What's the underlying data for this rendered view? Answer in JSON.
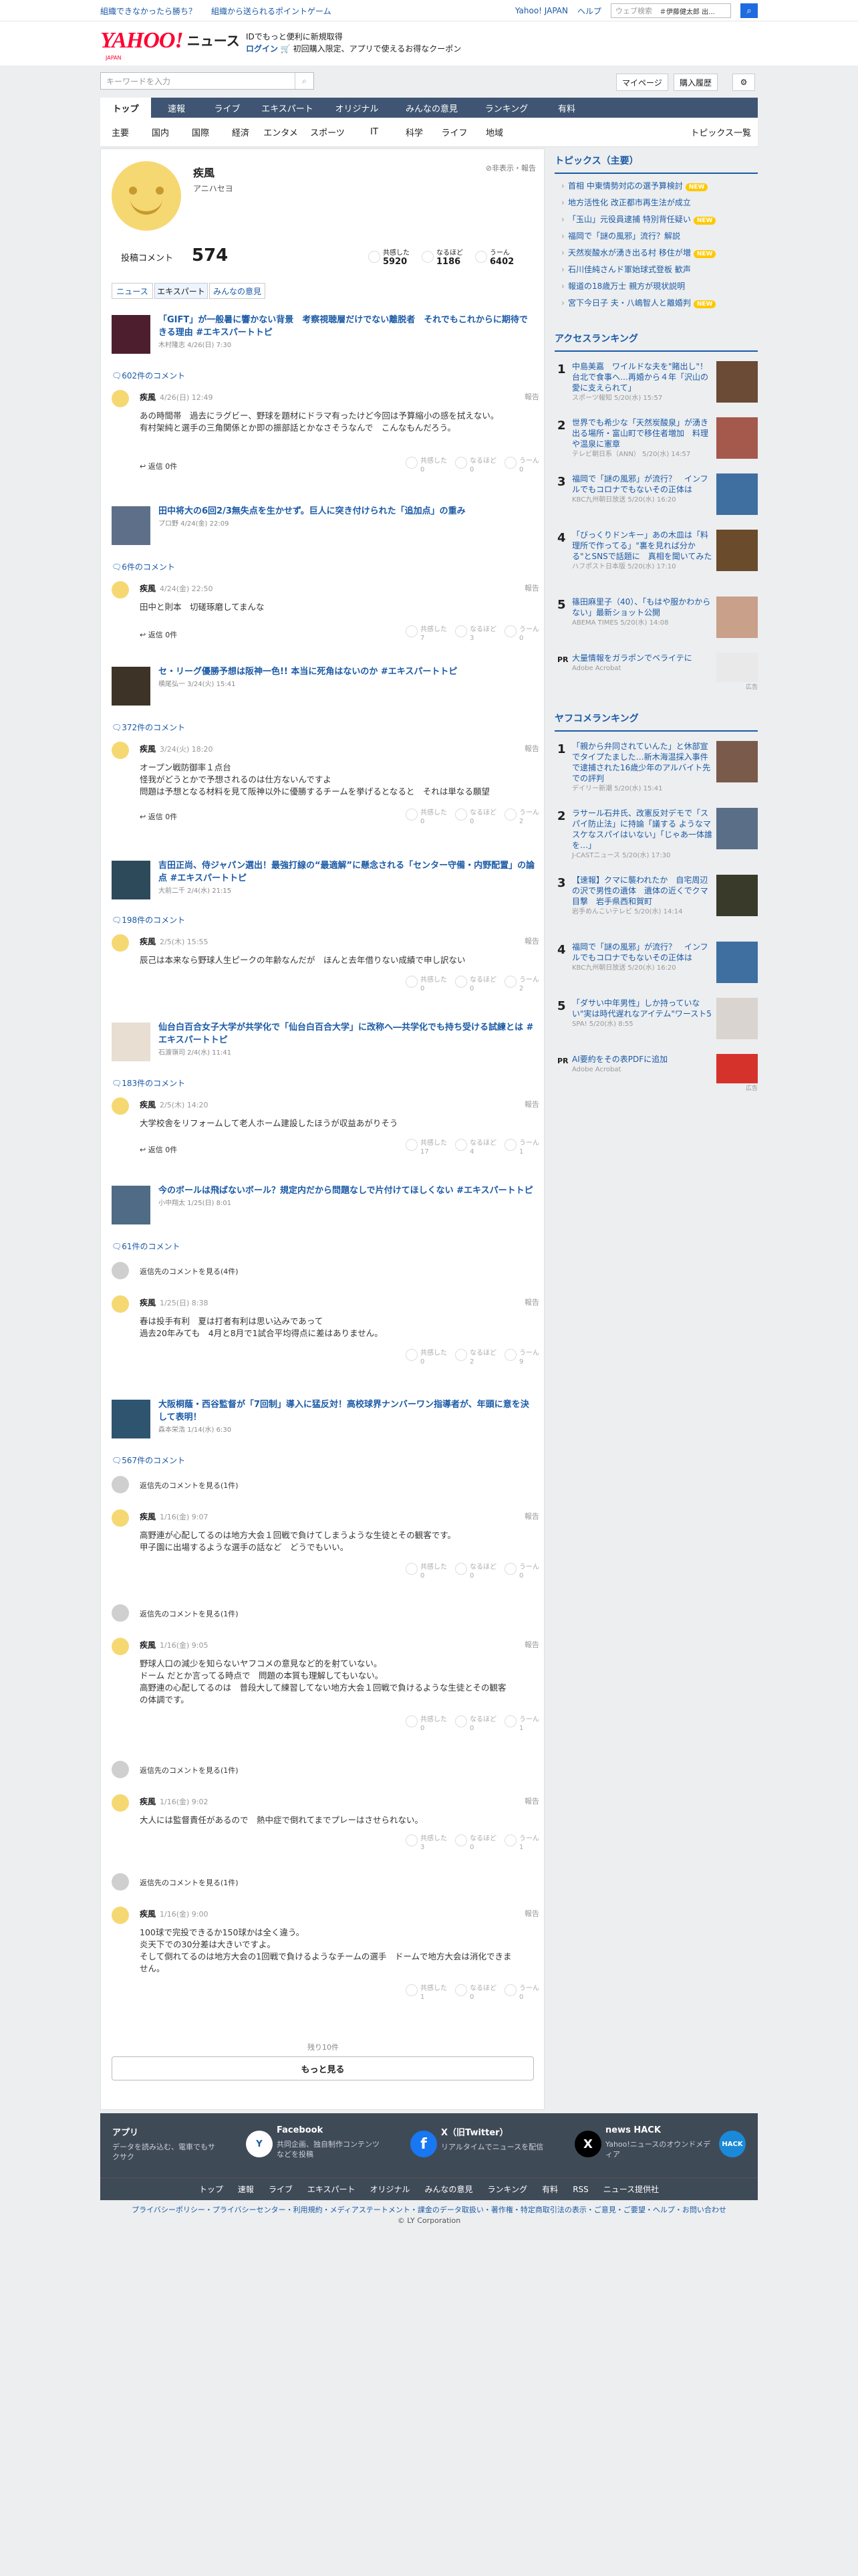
{
  "topbar": {
    "left_links": [
      "組織できなかったら勝ち？",
      "組織から送られるポイントゲーム"
    ],
    "right_links": [
      "Yahoo! JAPAN",
      "ヘルプ"
    ],
    "search_placeholder": "ウェブ検索",
    "search_value": "＃伊藤健太郎 出..."
  },
  "header": {
    "logo_text": "YAHOO!",
    "logo_sub": "JAPAN",
    "section": "ニュース",
    "promo_line1": "IDでもっと便利に新規取得",
    "promo_line2_prefix": "ログイン",
    "promo_line2": "初回購入限定、アプリで使えるお得なクーポン"
  },
  "subheader": {
    "keyword_placeholder": "キーワードを入力",
    "mypage": "マイページ",
    "purchase_history": "購入履歴"
  },
  "gnav": [
    "トップ",
    "速報",
    "ライブ",
    "エキスパート",
    "オリジナル",
    "みんなの意見",
    "ランキング",
    "有料"
  ],
  "snav": {
    "items": [
      "主要",
      "国内",
      "国際",
      "経済",
      "エンタメ",
      "スポーツ",
      "IT",
      "科学",
      "ライフ",
      "地域"
    ],
    "topics_list": "トピックス一覧"
  },
  "profile": {
    "name": "疾風",
    "reading": "アニハセヨ",
    "hide_report": "非表示・報告",
    "comments_label": "投稿コメント",
    "comments_count": "574",
    "stats": [
      {
        "label": "共感した",
        "value": "5920"
      },
      {
        "label": "なるほど",
        "value": "1186"
      },
      {
        "label": "うーん",
        "value": "6402"
      }
    ],
    "tabs": [
      "ニュース",
      "エキスパート",
      "みんなの意見"
    ]
  },
  "articles": [
    {
      "title": "「GIFT」が一般暑に響かない背景　考察視聴層だけでない離脱者　それでもこれからに期待できる理由 #エキスパートトピ",
      "meta": "木村隆志 4/26(日) 7:30",
      "comments": "602件のコメント"
    },
    {
      "title": "田中将大の6回2/3無失点を生かせず。巨人に突き付けられた「追加点」の重み",
      "meta": "プロ野 4/24(金) 22:09",
      "comments": "6件のコメント"
    },
    {
      "title": "セ・リーグ優勝予想は阪神一色!! 本当に死角はないのか #エキスパートトピ",
      "meta": "横尾弘一 3/24(火) 15:41",
      "comments": "372件のコメント"
    },
    {
      "title": "吉田正尚、侍ジャパン選出！最強打線の“最適解”に懸念される「センター守備・内野配置」の論点 #エキスパートトピ",
      "meta": "大前二千 2/4(水) 21:15",
      "comments": "198件のコメント"
    },
    {
      "title": "仙台白百合女子大学が共学化で「仙台白百合大学」に改称へ―共学化でも持ち受ける試練とは #エキスパートトピ",
      "meta": "石渡嶺司 2/4(水) 11:41",
      "comments": "183件のコメント"
    },
    {
      "title": "今のボールは飛ばないボール？規定内だから問題なしで片付けてほしくない #エキスパートトピ",
      "meta": "小中翔太 1/25(日) 8:01",
      "comments": "61件のコメント"
    },
    {
      "title": "大阪桐蔭・西谷監督が「7回制」導入に猛反対！高校球界ナンバーワン指導者が、年頭に意を決して表明！",
      "meta": "森本栄浩 1/14(水) 6:30",
      "comments": "567件のコメント"
    }
  ],
  "comments": [
    {
      "name": "疾風",
      "date": "4/26(日) 12:49",
      "report": "報告",
      "body": "あの時間帯　過去にラグビー、野球を題材にドラマ有ったけど今回は予算縮小の感を拭えない。\n有村架純と選手の三角関係とか即の振部話とかなさそうなんで　こんなもんだろう。",
      "reply": "返信 0件",
      "reacts": [
        "0",
        "0",
        "0"
      ]
    },
    {
      "name": "疾風",
      "date": "4/24(金) 22:50",
      "report": "報告",
      "body": "田中と則本　切磋琢磨してまんな",
      "reply": "返信 0件",
      "reacts": [
        "7",
        "3",
        "0"
      ]
    },
    {
      "name": "疾風",
      "date": "3/24(火) 18:20",
      "report": "報告",
      "body": "オープン戦防御率１点台\n怪我がどうとかで予想されるのは仕方ないんですよ\n問題は予想となる材料を見て阪神以外に優勝するチームを挙げるとなると　それは単なる願望",
      "reply": "返信 0件",
      "reacts": [
        "0",
        "0",
        "2"
      ]
    },
    {
      "name": "疾風",
      "date": "2/5(木) 15:55",
      "report": "報告",
      "body": "辰己は本来なら野球人生ピークの年齢なんだが　ほんと去年借りない成績で申し訳ない",
      "reply": "",
      "reacts": [
        "0",
        "0",
        "2"
      ]
    },
    {
      "name": "疾風",
      "date": "2/5(木) 14:20",
      "report": "報告",
      "body": "大学校舎をリフォームして老人ホーム建設したほうが収益あがりそう",
      "reply": "返信 0件",
      "reacts": [
        "17",
        "4",
        "1"
      ]
    },
    {
      "name": "疾風",
      "date": "1/25(日) 8:38",
      "report": "報告",
      "body": "春は投手有利　夏は打者有利は思い込みであって\n過去20年みても　4月と8月で1試合平均得点に差はありません。",
      "reply": "",
      "reacts": [
        "0",
        "2",
        "9"
      ]
    },
    {
      "name": "疾風",
      "date": "1/16(金) 9:07",
      "report": "報告",
      "body": "高野連が心配してるのは地方大会１回戦で負けてしまうような生徒とその観客です。\n甲子園に出場するような選手の話など　どうでもいい。",
      "reply": "",
      "reacts": [
        "0",
        "0",
        "0"
      ]
    },
    {
      "name": "疾風",
      "date": "1/16(金) 9:05",
      "report": "報告",
      "body": "野球人口の減少を知らないヤフコメの意見など的を射ていない。\nドーム だとか言ってる時点で　問題の本質も理解してもいない。\n高野連の心配してるのは　普段大して練習してない地方大会１回戦で負けるような生徒とその観客の体調です。",
      "reply": "",
      "reacts": [
        "0",
        "0",
        "1"
      ]
    },
    {
      "name": "疾風",
      "date": "1/16(金) 9:02",
      "report": "報告",
      "body": "大人には監督責任があるので　熱中症で倒れてまでプレーはさせられない。",
      "reply": "",
      "reacts": [
        "3",
        "0",
        "1"
      ]
    },
    {
      "name": "疾風",
      "date": "1/16(金) 9:00",
      "report": "報告",
      "body": "100球で完投できるか150球かは全く違う。\n炎天下での30分差は大きいですよ。\nそして倒れてるのは地方大会の1回戦で負けるようなチームの選手　ドームで地方大会は消化できません。",
      "reply": "",
      "reacts": [
        "1",
        "0",
        "0"
      ]
    }
  ],
  "react_labels": [
    "共感した",
    "なるほど",
    "うーん"
  ],
  "more_replies": "返信先のコメントを見る(1件)",
  "more_replies_4": "返信先のコメントを見る(4件)",
  "remaining": "残り10件",
  "load_more": "もっと見る",
  "sidebar": {
    "topics_title": "トピックス（主要）",
    "topics": [
      {
        "text": "首相 中東情勢対応の選予算検討",
        "new": true
      },
      {
        "text": "地方活性化 改正都市再生法が成立",
        "new": false
      },
      {
        "text": "「玉山」元役員逮捕 特別背任疑い",
        "new": true
      },
      {
        "text": "福岡で「謎の風邪」流行？解説",
        "new": false
      },
      {
        "text": "天然炭酸水が湧き出る村 移住が増",
        "new": true
      },
      {
        "text": "石川佳純さんド軍始球式登板 歓声",
        "new": false
      },
      {
        "text": "報道の18歳万士 親方が現状説明",
        "new": false
      },
      {
        "text": "宮下今日子 夫・八嶋智人と離婚判",
        "new": true
      }
    ],
    "new_label": "NEW",
    "access_title": "アクセスランキング",
    "access": [
      {
        "title": "中島美嘉　ワイルドな夫を\"賭出し\"！台北で食事へ…再婚から４年「沢山の愛に支えられて」",
        "meta": "スポーツ報知 5/20(水) 15:57"
      },
      {
        "title": "世界でも希少な「天然炭酸泉」が湧き出る場所・富山町で移住者増加　料理や温泉に憲章",
        "meta": "テレビ朝日系（ANN） 5/20(水) 14:57"
      },
      {
        "title": "福岡で「謎の風邪」が流行？　インフルでもコロナでもないその正体は",
        "meta": "KBC九州朝日放送 5/20(水) 16:20"
      },
      {
        "title": "「びっくりドンキー」あの木皿は「料理所で作ってる」\"裏を見れば分かる\"とSNSで話題に　真相を聞いてみた",
        "meta": "ハフポスト日本版 5/20(水) 17:10"
      },
      {
        "title": "篠田麻里子（40）、「もはや服かわからない」最新ショット公開",
        "meta": "ABEMA TIMES 5/20(水) 14:08"
      }
    ],
    "pr1_title": "大量情報をガラポンでベライテに",
    "pr1_sponsor": "Adobe Acrobat",
    "ad_label": "広告",
    "yafu_title": "ヤフコメランキング",
    "yafu": [
      {
        "title": "「親から弁同されていんた」と休部宣でタイプたました…新木海温採入事件で逮捕された16歳少年のアルバイト先での評判",
        "meta": "デイリー新潮 5/20(水) 15:41"
      },
      {
        "title": "ラサール石井氏、改憲反対デモで「スパイ防止法」に持論「議する ようなマスケなスパイはいない」「じゃあ一体誰を…」",
        "meta": "J-CASTニュース 5/20(水) 17:30"
      },
      {
        "title": "【速報】クマに襲われたか　自宅周辺の沢で男性の遺体　遺体の近くでクマ目撃　岩手県西和賀町",
        "meta": "岩手めんこいテレビ 5/20(水) 14:14"
      },
      {
        "title": "福岡で「謎の風邪」が流行？　インフルでもコロナでもないその正体は",
        "meta": "KBC九州朝日放送 5/20(水) 16:20"
      },
      {
        "title": "「ダサい中年男性」しか持っていない\"実は時代遅れなアイテム\"ワースト5",
        "meta": "SPA! 5/20(水) 8:55"
      }
    ],
    "pr2_title": "AI要約をその表PDFに追加",
    "pr2_sponsor": "Adobe Acrobat"
  },
  "footer": {
    "cols": [
      {
        "title": "アプリ",
        "desc": "データを読み込む、電車でもサクサク",
        "icon": "Y"
      },
      {
        "title": "Facebook",
        "desc": "共同企画、独自制作コンテンツなどを投稿",
        "icon": "f"
      },
      {
        "title": "X（旧Twitter）",
        "desc": "リアルタイムでニュースを配信",
        "icon": "X"
      },
      {
        "title": "news HACK",
        "desc": "Yahoo!ニュースのオウンドメディア",
        "icon": "HACK"
      }
    ],
    "nav": [
      "トップ",
      "速報",
      "ライブ",
      "エキスパート",
      "オリジナル",
      "みんなの意見",
      "ランキング",
      "有料",
      "RSS",
      "ニュース提供社"
    ],
    "legal": "プライバシーポリシー・プライバシーセンター・利用規約・メディアステートメント・課金のデータ取扱い・著作権・特定商取引法の表示・ご意見・ご要望・ヘルプ・お問い合わせ",
    "copyright": "© LY Corporation"
  },
  "colors": {
    "accent": "#1b5aa6",
    "nav": "#3f5573",
    "brand": "#ff0033",
    "footer": "#3f4a57"
  }
}
